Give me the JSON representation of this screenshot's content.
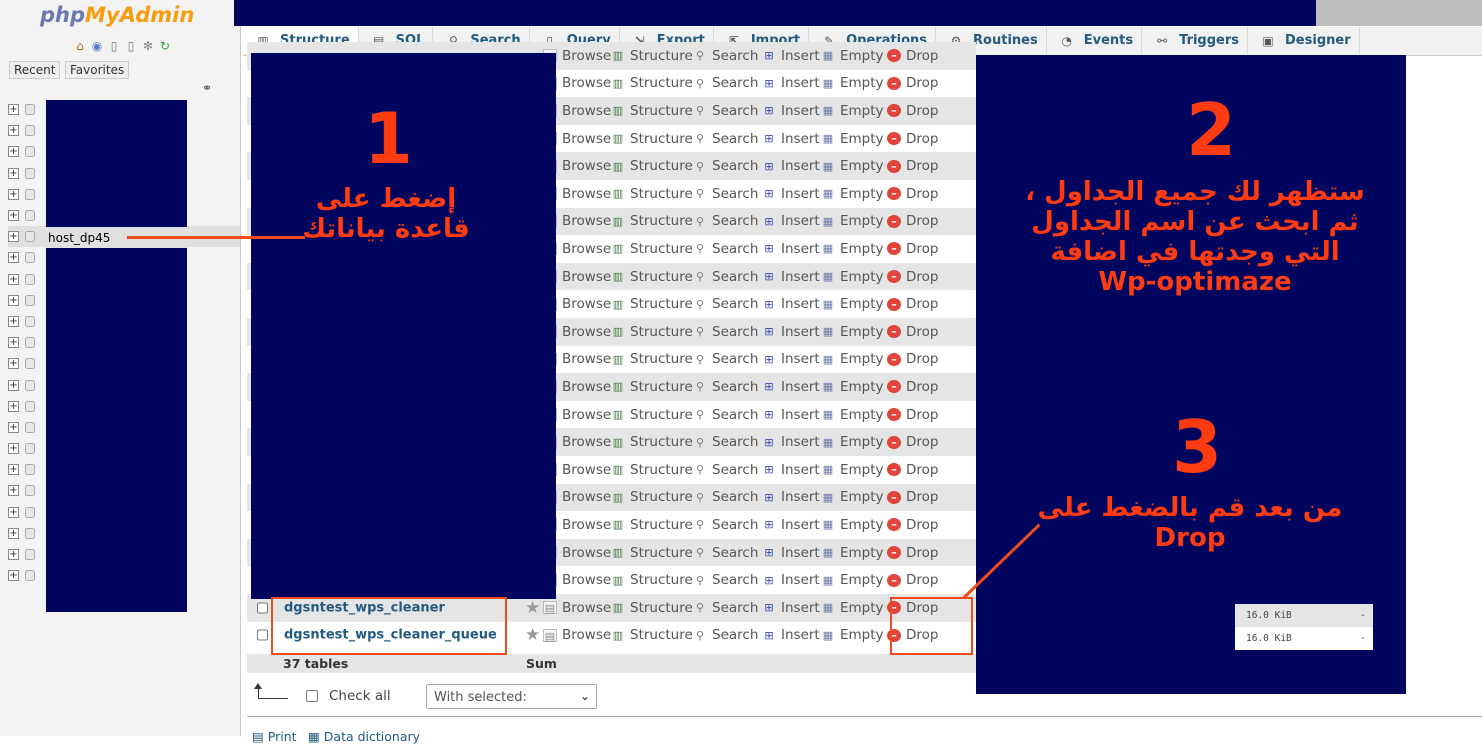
{
  "nav": {
    "logo_php": "php",
    "logo_myadmin": "MyAdmin",
    "recent_label": "Recent",
    "favorites_label": "Favorites",
    "selected_db": "host_dp45",
    "db_count": 23
  },
  "tabs": [
    {
      "label": "Structure",
      "icon": "structure-icon"
    },
    {
      "label": "SQL",
      "icon": "sql-icon"
    },
    {
      "label": "Search",
      "icon": "search-icon"
    },
    {
      "label": "Query",
      "icon": "query-icon"
    },
    {
      "label": "Export",
      "icon": "export-icon"
    },
    {
      "label": "Import",
      "icon": "import-icon"
    },
    {
      "label": "Operations",
      "icon": "wrench-icon"
    },
    {
      "label": "Routines",
      "icon": "routines-icon"
    },
    {
      "label": "Events",
      "icon": "clock-icon"
    },
    {
      "label": "Triggers",
      "icon": "triggers-icon"
    },
    {
      "label": "Designer",
      "icon": "designer-icon"
    }
  ],
  "row_actions": {
    "browse": "Browse",
    "structure": "Structure",
    "search": "Search",
    "insert": "Insert",
    "empty": "Empty",
    "drop": "Drop"
  },
  "visible_rows": 22,
  "named_tables": [
    {
      "name": "dgsntest_wps_cleaner",
      "size": "16.0 KiB",
      "overhead": "-"
    },
    {
      "name": "dgsntest_wps_cleaner_queue",
      "size": "16.0 KiB",
      "overhead": "-"
    }
  ],
  "footer": {
    "tables_count": "37 tables",
    "sum_label": "Sum",
    "check_all": "Check all",
    "with_selected": "With selected:",
    "print": "Print",
    "data_dictionary": "Data dictionary"
  },
  "annotations": {
    "step1_number": "1",
    "step1_text": "إضغط على قاعدة بياناتك",
    "step2_number": "2",
    "step2_text": "ستظهر لك جميع الجداول ، ثم ابحث عن اسم الجداول التي وجدتها في اضافة Wp-optimaze",
    "step3_number": "3",
    "step3_text": "من بعد قم بالضغط على Drop",
    "redaction_color": "#02055e",
    "annotation_color": "#ff3b12"
  }
}
